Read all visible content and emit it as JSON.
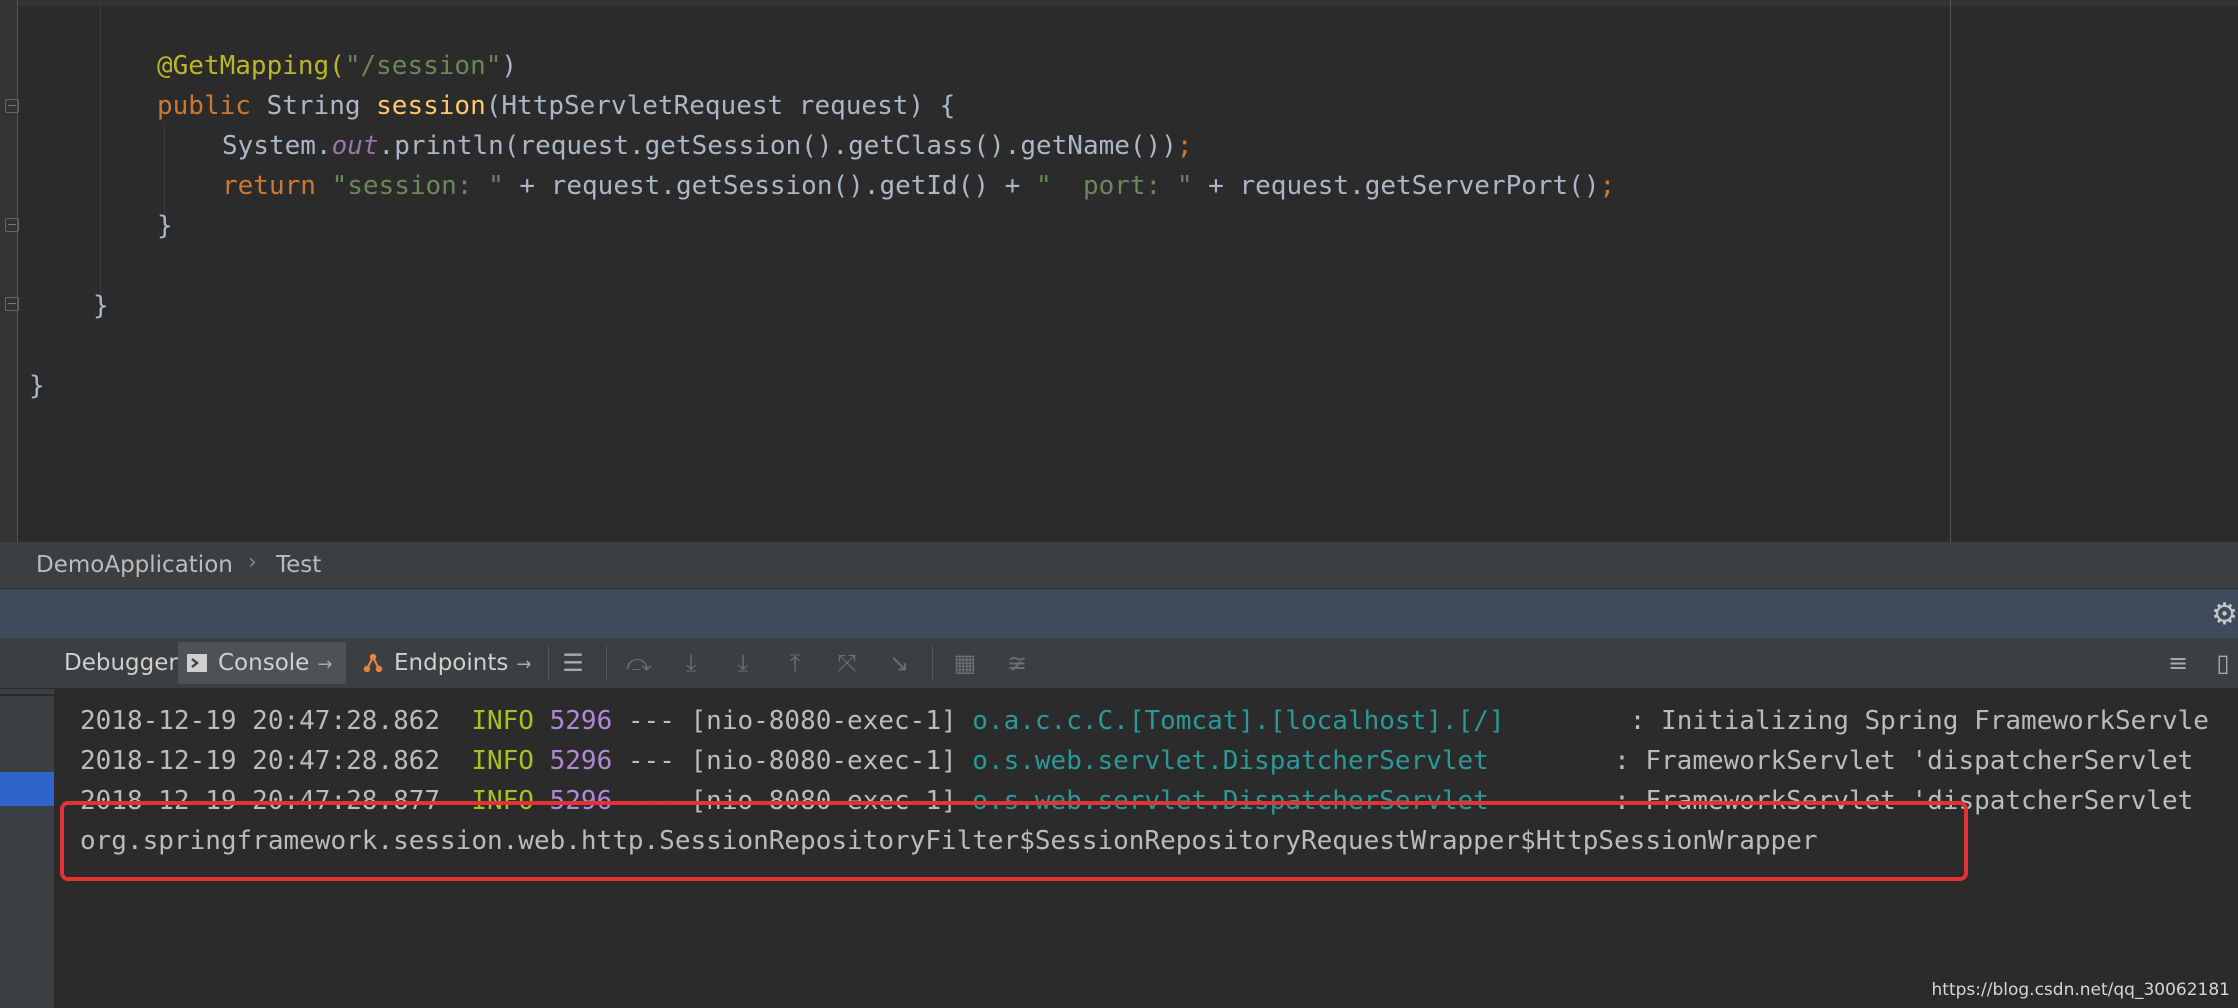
{
  "editor": {
    "lines": [
      {
        "parts": [
          [
            "anno",
            "@GetMapping("
          ],
          [
            "str",
            "\"/session\""
          ],
          [
            "plain",
            ")"
          ]
        ]
      },
      {
        "parts": [
          [
            "kw",
            "public "
          ],
          [
            "plain",
            "String "
          ],
          [
            "fn",
            "session"
          ],
          [
            "plain",
            "(HttpServletRequest request) {"
          ]
        ]
      },
      {
        "parts": [
          [
            "plain",
            "System."
          ],
          [
            "st",
            "out"
          ],
          [
            "plain",
            ".println(request.getSession().getClass().getName())"
          ],
          [
            "semi",
            ";"
          ]
        ]
      },
      {
        "parts": [
          [
            "kw",
            "return "
          ],
          [
            "str",
            "\"session: \""
          ],
          [
            "plain",
            " + request.getSession().getId() + "
          ],
          [
            "str",
            "\"  port: \""
          ],
          [
            "plain",
            " + request.getServerPort()"
          ],
          [
            "semi",
            ";"
          ]
        ]
      },
      {
        "parts": [
          [
            "plain",
            "}"
          ]
        ]
      },
      {
        "parts": [
          [
            "plain",
            "}"
          ]
        ]
      },
      {
        "parts": [
          [
            "plain",
            "}"
          ]
        ]
      }
    ]
  },
  "breadcrumb": {
    "items": [
      "DemoApplication",
      "Test"
    ],
    "separator": "›"
  },
  "tool_window": {
    "tabs": [
      {
        "label": "Debugger",
        "icon": "",
        "pin": ""
      },
      {
        "label": "Console",
        "icon": "console-icon",
        "pin": "→"
      },
      {
        "label": "Endpoints",
        "icon": "endpoints-icon",
        "pin": "→"
      }
    ],
    "toolbar_icons": [
      "menu-icon",
      "step-over-icon",
      "step-into-icon",
      "force-step-into-icon",
      "step-out-icon",
      "drop-frame-icon",
      "run-to-cursor-icon",
      "evaluate-icon",
      "trace-icon"
    ],
    "right_icons": [
      "scroll-end-icon",
      "layout-icon"
    ]
  },
  "console": {
    "lines": [
      {
        "parts": [
          [
            "plain",
            "2018-12-19 20:47:28.862  "
          ],
          [
            "info",
            "INFO"
          ],
          [
            "plain",
            " "
          ],
          [
            "pid",
            "5296"
          ],
          [
            "plain",
            " --- [nio-8080-exec-1] "
          ],
          [
            "cls",
            "o.a.c.c.C.[Tomcat].[localhost].[/]      "
          ],
          [
            "plain",
            "  : Initializing Spring FrameworkServle"
          ]
        ]
      },
      {
        "parts": [
          [
            "plain",
            "2018-12-19 20:47:28.862  "
          ],
          [
            "info",
            "INFO"
          ],
          [
            "plain",
            " "
          ],
          [
            "pid",
            "5296"
          ],
          [
            "plain",
            " --- [nio-8080-exec-1] "
          ],
          [
            "cls",
            "o.s.web.servlet.DispatcherServlet      "
          ],
          [
            "plain",
            "  : FrameworkServlet 'dispatcherServlet"
          ]
        ]
      },
      {
        "parts": [
          [
            "plain",
            "2018-12-19 20:47:28.877  "
          ],
          [
            "info",
            "INFO"
          ],
          [
            "plain",
            " "
          ],
          [
            "pid",
            "5296"
          ],
          [
            "plain",
            " --- [nio-8080-exec-1] "
          ],
          [
            "cls",
            "o.s.web.servlet.DispatcherServlet      "
          ],
          [
            "plain",
            "  : FrameworkServlet 'dispatcherServlet"
          ]
        ]
      },
      {
        "parts": [
          [
            "plain",
            "org.springframework.session.web.http.SessionRepositoryFilter$SessionRepositoryRequestWrapper$HttpSessionWrapper"
          ]
        ]
      }
    ]
  },
  "watermark": "https://blog.csdn.net/qq_30062181",
  "colors": {
    "annotation": "#bbb529",
    "string": "#6a8759",
    "keyword": "#cc7832",
    "method": "#ffc66d",
    "static_field": "#9876aa",
    "log_info": "#a8c023",
    "log_pid": "#b388d8",
    "log_class": "#299999",
    "highlight_box": "#e13333"
  }
}
